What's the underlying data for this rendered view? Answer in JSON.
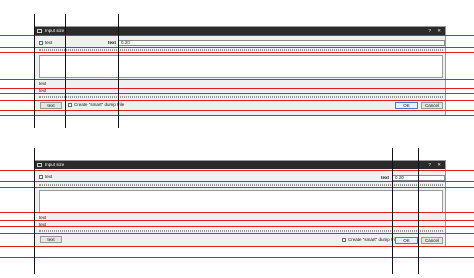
{
  "dialogs": [
    {
      "title": "Input size",
      "help_glyph": "?",
      "close_glyph": "✕",
      "checkbox_label": "text",
      "field_label": "text",
      "field_value": "0.20",
      "list_item_1": "text",
      "list_item_2": "text",
      "text_button": "text",
      "dump_label": "Create \"smart\" dump File",
      "ok_button": "OK",
      "cancel_button": "Cancel"
    },
    {
      "title": "Input size",
      "help_glyph": "?",
      "close_glyph": "✕",
      "checkbox_label": "text",
      "field_label": "text",
      "field_value": "0.20",
      "list_item_1": "text",
      "list_item_2": "text",
      "text_button": "text",
      "dump_label": "Create \"smart\" dump File",
      "ok_button": "OK",
      "cancel_button": "Cancel"
    }
  ],
  "colors": {
    "titlebar": "#2b2b2b",
    "guide_red": "#e02020",
    "guide_black": "#111111",
    "ok_border": "#3c7fd6"
  }
}
